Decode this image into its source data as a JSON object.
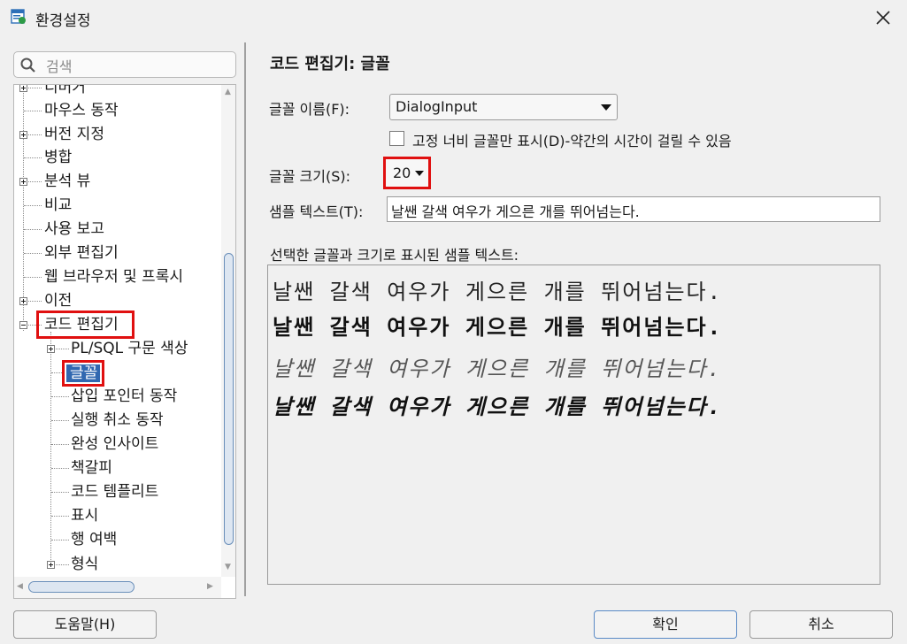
{
  "window": {
    "title": "환경설정"
  },
  "search": {
    "placeholder": "검색"
  },
  "tree": {
    "items": [
      {
        "label": "디버거"
      },
      {
        "label": "마우스 동작"
      },
      {
        "label": "버전 지정"
      },
      {
        "label": "병합"
      },
      {
        "label": "분석 뷰"
      },
      {
        "label": "비교"
      },
      {
        "label": "사용 보고"
      },
      {
        "label": "외부 편집기"
      },
      {
        "label": "웹 브라우저 및 프록시"
      },
      {
        "label": "이전"
      },
      {
        "label": "코드 편집기"
      },
      {
        "label": "PL/SQL 구문 색상"
      },
      {
        "label": "글꼴",
        "selected": true
      },
      {
        "label": "삽입 포인터 동작"
      },
      {
        "label": "실행 취소 동작"
      },
      {
        "label": "완성 인사이트"
      },
      {
        "label": "책갈피"
      },
      {
        "label": "코드 템플리트"
      },
      {
        "label": "표시"
      },
      {
        "label": "행 여백"
      },
      {
        "label": "형식"
      }
    ]
  },
  "panel": {
    "title": "코드 편집기: 글꼴",
    "font_name_label": "글꼴 이름(F):",
    "font_name_value": "DialogInput",
    "fixed_width_label": "고정 너비 글꼴만 표시(D)-약간의 시간이 걸릴 수 있음",
    "font_size_label": "글꼴 크기(S):",
    "font_size_value": "20",
    "sample_text_label": "샘플 텍스트(T):",
    "sample_text_value": "날쌘 갈색 여우가 게으른 개를 뛰어넘는다.",
    "preview_label": "선택한 글꼴과 크기로 표시된 샘플 텍스트:",
    "preview_lines": [
      "날쌘 갈색 여우가 게으른 개를 뛰어넘는다.",
      "날쌘 갈색 여우가 게으른 개를 뛰어넘는다.",
      "날쌘 갈색 여우가 게으른 개를 뛰어넘는다.",
      "날쌘 갈색 여우가 게으른 개를 뛰어넘는다."
    ]
  },
  "buttons": {
    "help": "도움말(H)",
    "ok": "확인",
    "cancel": "취소"
  },
  "colors": {
    "selection": "#3168b0",
    "highlight_box": "#e01010"
  }
}
